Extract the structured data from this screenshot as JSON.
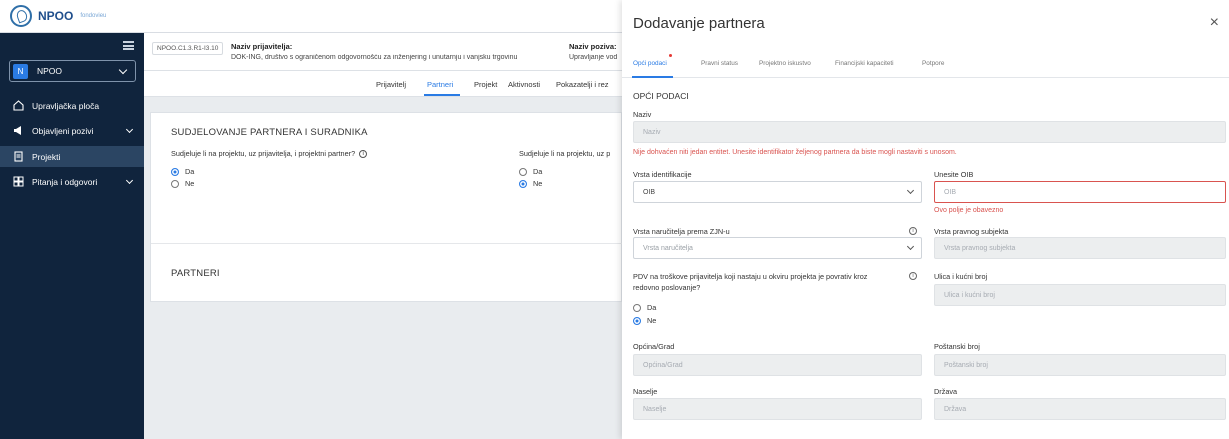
{
  "app": {
    "logo_text": "NPOO",
    "logo_sub": "fondovieu"
  },
  "sidebar": {
    "select": {
      "badge": "N",
      "label": "NPOO"
    },
    "items": [
      {
        "label": "Upravljačka ploča",
        "icon": "home-icon"
      },
      {
        "label": "Objavljeni pozivi",
        "icon": "megaphone-icon"
      },
      {
        "label": "Projekti",
        "icon": "document-icon"
      },
      {
        "label": "Pitanja i odgovori",
        "icon": "qa-icon"
      }
    ]
  },
  "infobar": {
    "code": "NPOO.C1.3.R1-I3.10",
    "applicant_label": "Naziv prijavitelja:",
    "applicant_value": "DOK-ING, društvo s ograničenom odgovornošću za inženjering i unutarnju i vanjsku trgovinu",
    "call_label": "Naziv poziva:",
    "call_value": "Upravljanje vod"
  },
  "main_tabs": [
    "Prijavitelj",
    "Partneri",
    "Projekt",
    "Aktivnosti",
    "Pokazatelji i rez"
  ],
  "partners_card": {
    "section_title": "SUDJELOVANJE PARTNERA I SURADNIKA",
    "q1": "Sudjeluje li na projektu, uz prijavitelja, i projektni partner?",
    "q1_info": "i",
    "q2": "Sudjeluje li na projektu, uz p",
    "yes": "Da",
    "no": "Ne",
    "partners_title": "PARTNERI"
  },
  "drawer": {
    "title": "Dodavanje partnera",
    "close": "×",
    "tabs": [
      "Opći podaci",
      "Pravni status",
      "Projektno iskustvo",
      "Financijski kapaciteti",
      "Potpore"
    ],
    "section": "OPĆI PODACI",
    "naziv_label": "Naziv",
    "naziv_placeholder": "Naziv",
    "entity_error": "Nije dohvaćen niti jedan entitet. Unesite identifikator željenog partnera da biste mogli nastaviti s unosom.",
    "id_type_label": "Vrsta identifikacije",
    "id_type_value": "OIB",
    "oib_label": "Unesite OIB",
    "oib_placeholder": "OIB",
    "oib_error": "Ovo polje je obavezno",
    "buyer_type_label": "Vrsta naručitelja prema ZJN-u",
    "buyer_type_placeholder": "Vrsta naručitelja",
    "legal_type_label": "Vrsta pravnog subjekta",
    "legal_type_placeholder": "Vrsta pravnog subjekta",
    "vat_question_line1": "PDV na troškove prijavitelja koji nastaju u okviru projekta je povrativ kroz",
    "vat_question_line2": "redovno poslovanje?",
    "street_label": "Ulica i kućni broj",
    "street_placeholder": "Ulica i kućni broj",
    "yes": "Da",
    "no": "Ne",
    "city_label": "Općina/Grad",
    "city_placeholder": "Općina/Grad",
    "postal_label": "Poštanski broj",
    "postal_placeholder": "Poštanski broj",
    "settlement_label": "Naselje",
    "settlement_placeholder": "Naselje",
    "country_label": "Država",
    "country_placeholder": "Država",
    "info_glyph": "i"
  },
  "colors": {
    "accent": "#2a7be4",
    "sidebar_bg": "#10243d",
    "error": "#d9534f"
  }
}
